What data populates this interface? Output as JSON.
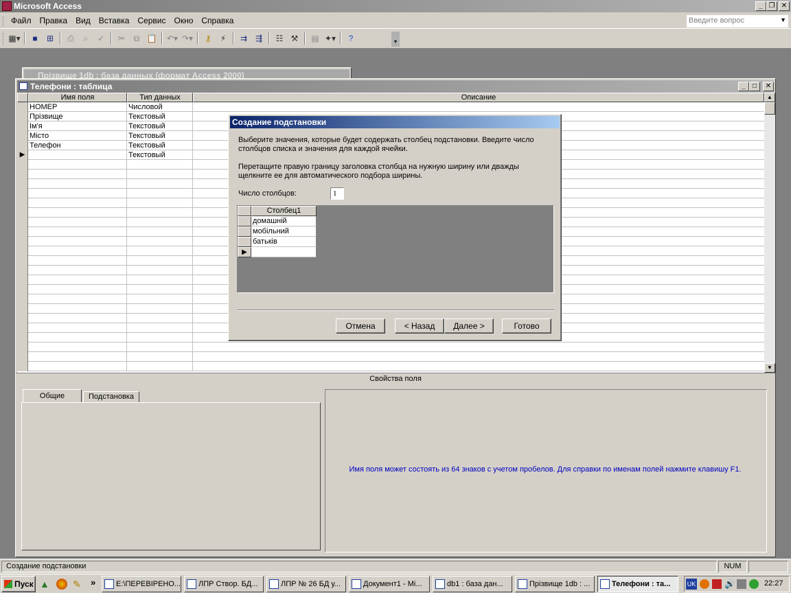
{
  "app": {
    "title": "Microsoft Access",
    "help_placeholder": "Введите вопрос"
  },
  "menu": [
    "Файл",
    "Правка",
    "Вид",
    "Вставка",
    "Сервис",
    "Окно",
    "Справка"
  ],
  "toolbar": {
    "icons": [
      "view-icon",
      "save-icon",
      "save-copy-icon",
      "print-icon",
      "print-preview-icon",
      "spelling-icon",
      "cut-icon",
      "copy-icon",
      "paste-icon",
      "undo-icon",
      "redo-icon",
      "primary-key-icon",
      "indexes-icon",
      "insert-rows-icon",
      "delete-rows-icon",
      "properties-icon",
      "build-icon",
      "database-window-icon",
      "new-object-icon",
      "help-icon"
    ]
  },
  "bg_window": {
    "title": "Прізвище 1db : база данных (формат Access 2000)"
  },
  "table_window": {
    "title": "Телефони : таблица",
    "columns": [
      "Имя поля",
      "Тип данных",
      "Описание"
    ],
    "rows": [
      {
        "name": "НОМЕР",
        "type": "Числовой"
      },
      {
        "name": "Прізвище",
        "type": "Текстовый"
      },
      {
        "name": "Ім'я",
        "type": "Текстовый"
      },
      {
        "name": "Місто",
        "type": "Текстовый"
      },
      {
        "name": "Телефон",
        "type": "Текстовый"
      },
      {
        "name": "",
        "type": "Текстовый"
      }
    ],
    "properties_label": "Свойства поля",
    "tabs": [
      "Общие",
      "Подстановка"
    ],
    "hint": "Имя поля может состоять из 64 знаков с учетом пробелов.  Для справки по именам полей нажмите клавишу F1."
  },
  "dialog": {
    "title": "Создание подстановки",
    "text1_line1": "Выберите значения, которые будет содержать столбец подстановки. Введите число",
    "text1_line2": "столбцов списка и значения для каждой ячейки.",
    "text2_line1": "Перетащите правую границу заголовка столбца на нужную ширину или дважды",
    "text2_line2": "щелкните ее для автоматического подбора ширины.",
    "columns_label": "Число столбцов:",
    "columns_value": "1",
    "grid_header": "Столбец1",
    "grid_values": [
      "домашній",
      "мобільний",
      "батьків",
      ""
    ],
    "buttons": {
      "cancel": "Отмена",
      "back": "< Назад",
      "next": "Далее >",
      "finish": "Готово"
    }
  },
  "statusbar": {
    "text": "Создание подстановки",
    "num": "NUM"
  },
  "taskbar": {
    "start": "Пуск",
    "tasks": [
      "E:\\ПЕРЕВІРЕНО...",
      "ЛПР Створ. БД...",
      "ЛПР № 26 БД у...",
      "Документ1 - Mi...",
      "db1 : база дан...",
      "Прізвище 1db : ...",
      "Телефони : та..."
    ],
    "lang": "UK",
    "clock": "22:27"
  }
}
